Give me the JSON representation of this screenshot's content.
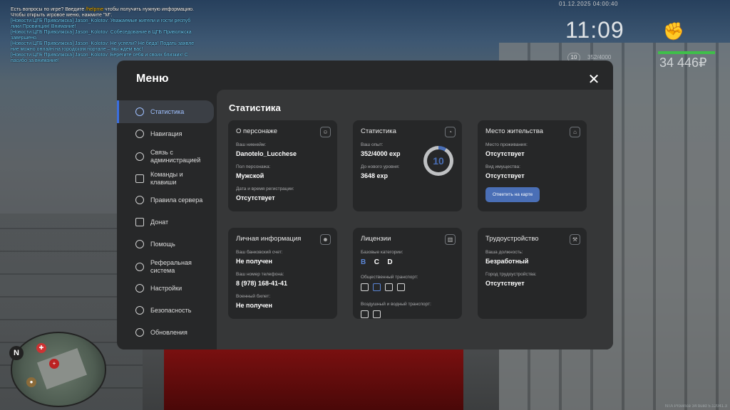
{
  "chat": [
    {
      "text": "Есть вопросы по игре? Введите ",
      "color": "w",
      "extra": "/helpme",
      "extra_color": "y",
      "tail": " чтобы получить нужную информацию."
    },
    {
      "text": "Чтобы открыть игровое меню, нажмите \"M\".",
      "color": "w"
    },
    {
      "text": "[Новости ЦГБ Приволжска] Jason_Kolotov: Уважаемые жители и гости респуб лики Провинция! Внимание!",
      "color": "c"
    },
    {
      "text": "[Новости ЦГБ Приволжска] Jason_Kolotov: Собеседование в ЦГБ Приволжска завершено.",
      "color": "c"
    },
    {
      "text": "[Новости ЦГБ Приволжска] Jason_Kolotov: Не успели? Не беда! Подать заявле ние можно онлайн на городском портале – мы ждем вас!",
      "color": "c"
    },
    {
      "text": "[Новости ЦГБ Приволжска] Jason_Kolotov: Берегите себя и своих близких! С пасибо за внимание!",
      "color": "c"
    }
  ],
  "hud": {
    "date": "01.12.2025 04:00:40",
    "time": "11:09",
    "level": "10",
    "exp": "352/4000",
    "money": "34 446₽",
    "build": "NTA Province 34 build 5.12041.3"
  },
  "minimap": {
    "north": "N"
  },
  "menu": {
    "title": "Меню",
    "close_icon": "close-icon",
    "nav": [
      {
        "label": "Статистика",
        "icon": "pie-chart-icon",
        "active": true
      },
      {
        "label": "Навигация",
        "icon": "compass-icon"
      },
      {
        "label": "Связь с администрацией",
        "icon": "message-icon"
      },
      {
        "label": "Команды и клавиши",
        "icon": "keyboard-icon"
      },
      {
        "label": "Правила сервера",
        "icon": "scales-icon"
      },
      {
        "label": "Донат",
        "icon": "wallet-icon"
      },
      {
        "label": "Помощь",
        "icon": "heart-hand-icon"
      },
      {
        "label": "Реферальная система",
        "icon": "network-icon"
      },
      {
        "label": "Настройки",
        "icon": "gear-icon"
      },
      {
        "label": "Безопасность",
        "icon": "shield-icon"
      },
      {
        "label": "Обновления",
        "icon": "refresh-icon"
      }
    ],
    "content_title": "Статистика",
    "cards": {
      "character": {
        "title": "О персонаже",
        "nick_label": "Ваш никнейм:",
        "nick": "Danotelo_Lucchese",
        "gender_label": "Пол персонажа:",
        "gender": "Мужской",
        "reg_label": "Дата и время регистрации:",
        "reg": "Отсутствует"
      },
      "stats": {
        "title": "Статистика",
        "exp_label": "Ваш опыт:",
        "exp": "352/4000 exp",
        "next_label": "До нового уровня:",
        "next": "3648 exp",
        "level": "10",
        "level_progress": 0.088
      },
      "residence": {
        "title": "Место жительства",
        "place_label": "Место проживания:",
        "place": "Отсутствует",
        "property_label": "Вид имущества:",
        "property": "Отсутствует",
        "button": "Отметить на карте"
      },
      "personal": {
        "title": "Личная информация",
        "bank_label": "Ваш банковский счет:",
        "bank": "Не получен",
        "phone_label": "Ваш номер телефона:",
        "phone": "8 (978) 168-41-41",
        "military_label": "Военный билет:",
        "military": "Не получен"
      },
      "licenses": {
        "title": "Лицензии",
        "base_label": "Базовые категории:",
        "categories": [
          "B",
          "C",
          "D"
        ],
        "public_label": "Общественный транспорт:",
        "air_label": "Воздушный и водный транспорт:"
      },
      "job": {
        "title": "Трудоустройство",
        "position_label": "Ваша должность:",
        "position": "Безработный",
        "city_label": "Город трудоустройства:",
        "city": "Отсутствует"
      }
    }
  }
}
